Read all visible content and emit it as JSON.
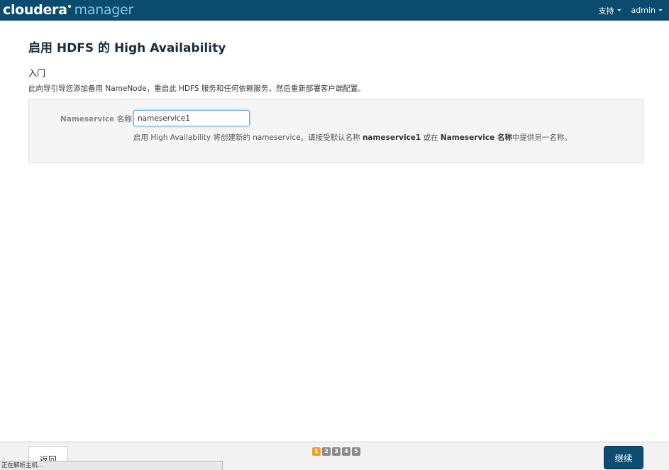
{
  "header": {
    "brand_part1": "cloudera",
    "brand_part2": "manager",
    "nav": [
      {
        "label": "支持",
        "icon": "chevron-down-icon"
      },
      {
        "label": "admin",
        "icon": "chevron-down-icon"
      }
    ]
  },
  "main": {
    "title": "启用 HDFS 的 High Availability",
    "section_title": "入门",
    "intro": "此向导引导您添加备用 NameNode，重启此 HDFS 服务和任何依赖服务，然后重新部署客户端配置。",
    "form": {
      "label": "Nameservice 名称",
      "value": "nameservice1",
      "help": {
        "part1": "启用 High Availability 将创建新的 nameservice。请接受默认名称 ",
        "bold1": "nameservice1",
        "part2": " 或在 ",
        "bold2": "Nameservice 名称",
        "part3": "中提供另一名称。"
      }
    }
  },
  "footer": {
    "back_label": "返回",
    "continue_label": "继续",
    "steps": [
      "1",
      "2",
      "3",
      "4",
      "5"
    ],
    "active_step": 1
  },
  "colors": {
    "topbar": "#0b4b6e",
    "brand_accent": "#7ec3e8",
    "primary_button": "#0e4d70",
    "active_step": "#f0a030"
  },
  "statusbar": {
    "text": "正在解析主机..."
  }
}
